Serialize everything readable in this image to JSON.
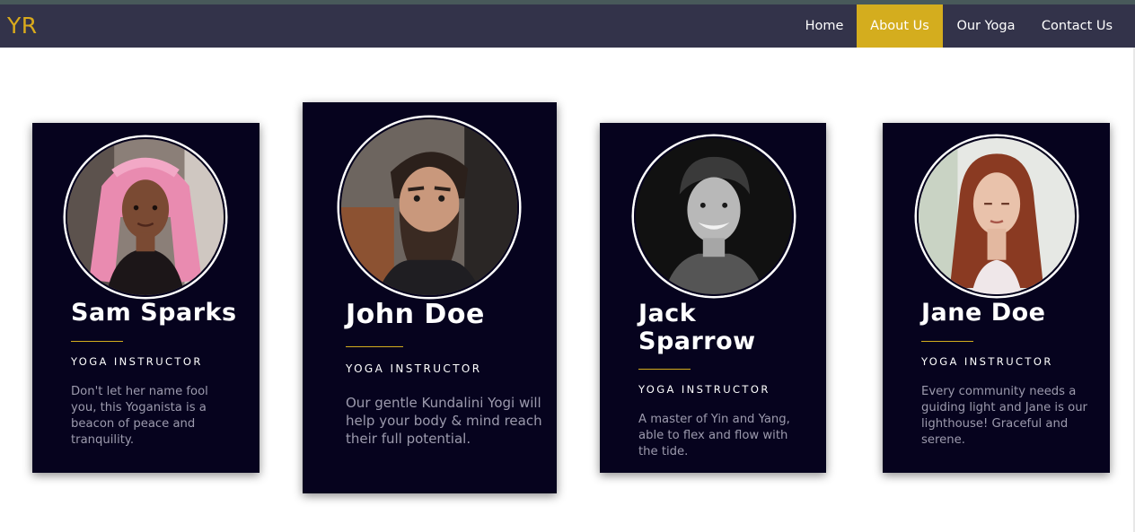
{
  "brand": {
    "logo": "YR",
    "accent": "#d4ad1e",
    "nav_bg": "#33334a",
    "card_bg": "#06031e"
  },
  "nav": {
    "items": [
      {
        "label": "Home",
        "active": false
      },
      {
        "label": "About Us",
        "active": true
      },
      {
        "label": "Our Yoga",
        "active": false
      },
      {
        "label": "Contact Us",
        "active": false
      }
    ]
  },
  "instructors": [
    {
      "name": "Sam Sparks",
      "role": "YOGA INSTRUCTOR",
      "bio": "Don't let her name fool you, this Yoganista is a beacon of peace and tranquility.",
      "photo": "portrait-woman-pink-braids"
    },
    {
      "name": "John Doe",
      "role": "YOGA INSTRUCTOR",
      "bio": "Our gentle Kundalini Yogi will help your body & mind reach their full potential.",
      "photo": "portrait-bearded-man"
    },
    {
      "name": "Jack Sparrow",
      "role": "YOGA INSTRUCTOR",
      "bio": "A master of Yin and Yang, able to flex and flow with the tide.",
      "photo": "portrait-smiling-man-bw"
    },
    {
      "name": "Jane Doe",
      "role": "YOGA INSTRUCTOR",
      "bio": "Every community needs a guiding light and Jane is our lighthouse! Graceful and serene.",
      "photo": "portrait-woman-red-hair"
    }
  ]
}
